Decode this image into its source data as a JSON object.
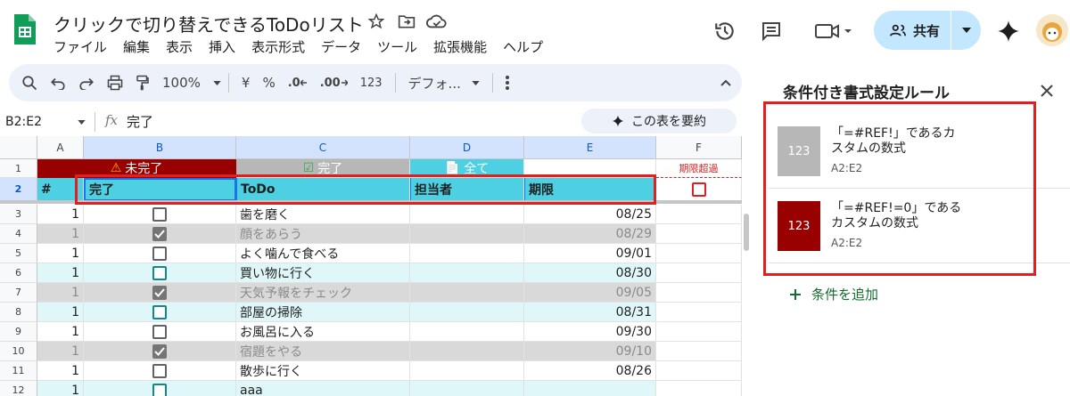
{
  "title": "クリックで切り替えできるToDoリスト",
  "menu": [
    "ファイル",
    "編集",
    "表示",
    "挿入",
    "表示形式",
    "データ",
    "ツール",
    "拡張機能",
    "ヘルプ"
  ],
  "share_label": "共有",
  "toolbar": {
    "zoom": "100%",
    "currency": "¥",
    "percent": "%",
    "dec_dec": ".0",
    "dec_inc": ".00",
    "num_format": "123",
    "font": "デフォ..."
  },
  "formula_bar": {
    "name_box": "B2:E2",
    "fx": "fx",
    "content": "完了"
  },
  "summarize_label": "この表を要約",
  "columns": [
    "A",
    "B",
    "C",
    "D",
    "E",
    "F"
  ],
  "row1": {
    "b": "未完了",
    "c": "完了",
    "d": "全て",
    "f": "期限超過"
  },
  "row2": {
    "a": "#",
    "b": "完了",
    "c": "ToDo",
    "d": "担当者",
    "e": "期限"
  },
  "rows": [
    {
      "num": "3",
      "a": "1",
      "checked": false,
      "todo": "歯を磨く",
      "date": "08/25"
    },
    {
      "num": "4",
      "a": "1",
      "checked": true,
      "todo": "顔をあらう",
      "date": "08/29"
    },
    {
      "num": "5",
      "a": "1",
      "checked": false,
      "todo": "よく噛んで食べる",
      "date": "09/01"
    },
    {
      "num": "6",
      "a": "1",
      "checked": false,
      "todo": "買い物に行く",
      "date": "08/30"
    },
    {
      "num": "7",
      "a": "1",
      "checked": true,
      "todo": "天気予報をチェック",
      "date": "09/05"
    },
    {
      "num": "8",
      "a": "1",
      "checked": false,
      "todo": "部屋の掃除",
      "date": "08/31"
    },
    {
      "num": "9",
      "a": "1",
      "checked": false,
      "todo": "お風呂に入る",
      "date": "09/30"
    },
    {
      "num": "10",
      "a": "1",
      "checked": true,
      "todo": "宿題をやる",
      "date": "09/10"
    },
    {
      "num": "11",
      "a": "1",
      "checked": false,
      "todo": "散歩に行く",
      "date": "08/26"
    },
    {
      "num": "12",
      "a": "1",
      "checked": false,
      "todo": "aaa",
      "date": ""
    }
  ],
  "panel": {
    "title": "条件付き書式設定ルール",
    "rules": [
      {
        "swatch_text": "123",
        "swatch_bg": "#b7b7b7",
        "swatch_fg": "#ffffff",
        "formula": "「=#REF!」であるカスタムの数式",
        "range": "A2:E2"
      },
      {
        "swatch_text": "123",
        "swatch_bg": "#990000",
        "swatch_fg": "#ffffff",
        "formula": "「=#REF!=0」であるカスタムの数式",
        "range": "A2:E2"
      }
    ],
    "add_label": "条件を追加"
  },
  "colors": {
    "accent": "#0b57d0",
    "header_cyan": "#4dd0e1",
    "dark_red": "#990000",
    "gray": "#b7b7b7",
    "highlight": "#e02020"
  }
}
